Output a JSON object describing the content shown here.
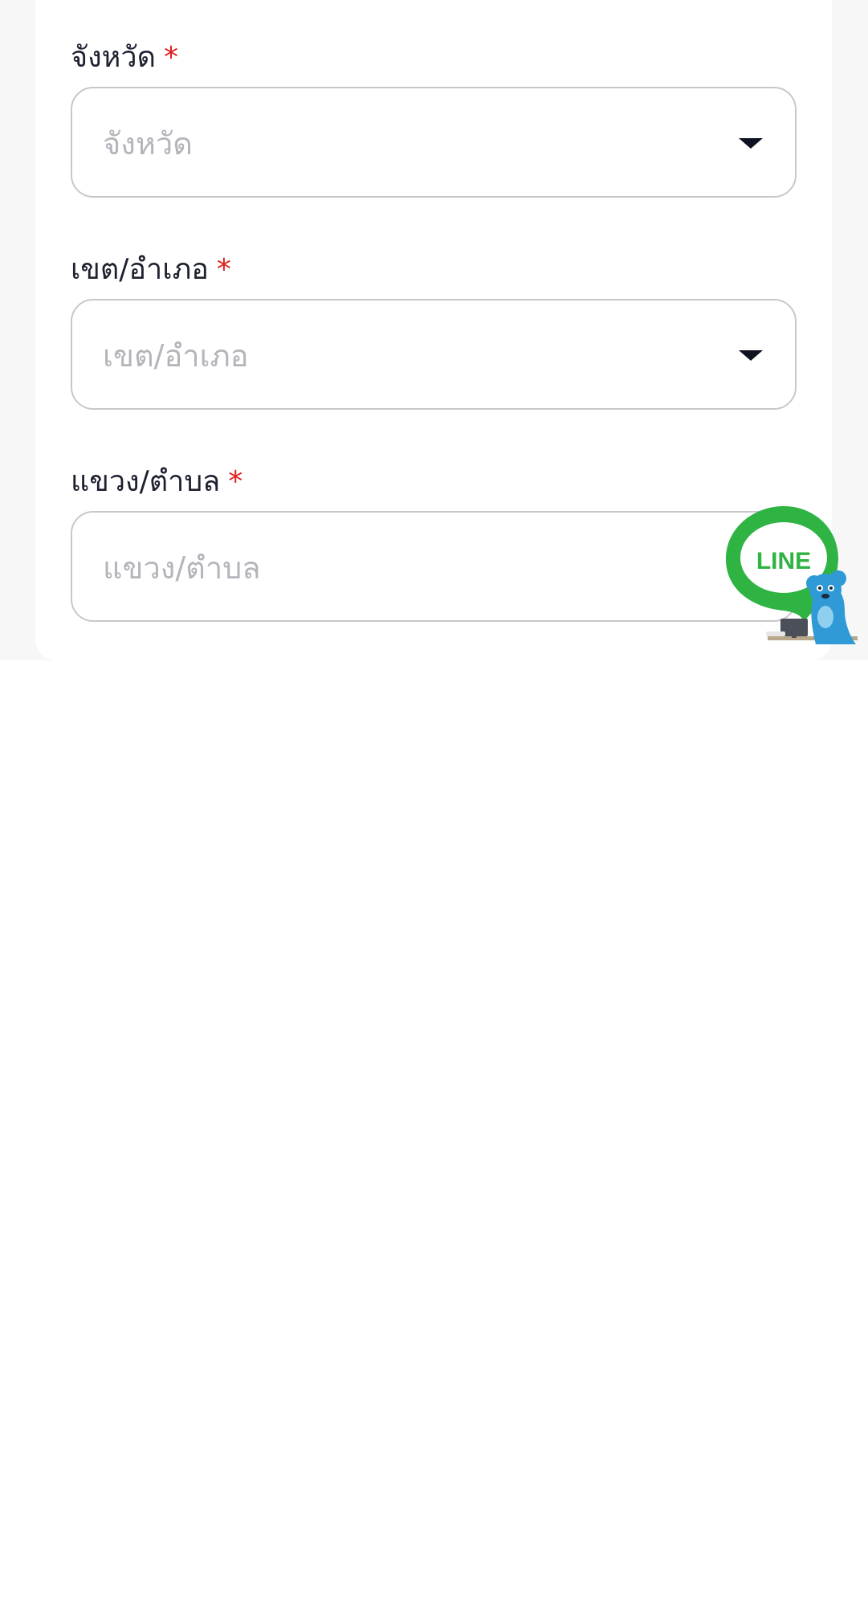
{
  "form": {
    "province": {
      "label": "จังหวัด",
      "required_mark": "*",
      "placeholder": "จังหวัด"
    },
    "district": {
      "label": "เขต/อำเภอ",
      "required_mark": "*",
      "placeholder": "เขต/อำเภอ"
    },
    "subdistrict": {
      "label": "แขวง/ตำบล",
      "required_mark": "*",
      "placeholder": "แขวง/ตำบล"
    }
  },
  "line_widget": {
    "text": "LINE",
    "icon": "line-chat-bubble-icon",
    "mascot": "bear-mascot-icon"
  },
  "colors": {
    "required": "#e02020",
    "line_green": "#2fb343",
    "mascot_blue": "#2f9ad6"
  }
}
